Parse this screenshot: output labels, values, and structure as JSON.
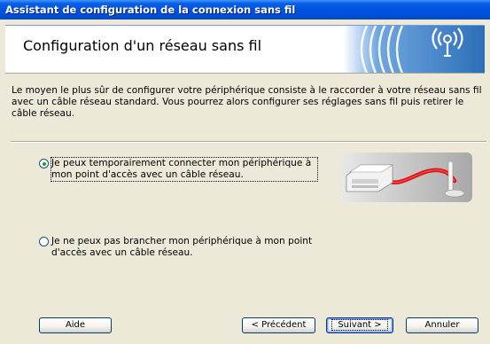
{
  "window": {
    "title": "Assistant de configuration de la connexion sans fil"
  },
  "header": {
    "title": "Configuration d'un réseau sans fil",
    "logo_icon": "wireless-signal-icon"
  },
  "intro_text": "Le moyen le plus sûr de configurer votre périphérique consiste à le raccorder à votre réseau sans fil avec un câble réseau standard. Vous pourrez alors configurer ses réglages sans fil puis retirer le câble réseau.",
  "options": [
    {
      "label": "Je peux temporairement connecter mon périphérique à mon point d'accès avec un câble réseau.",
      "selected": true
    },
    {
      "label": "Je ne peux pas brancher mon périphérique à mon point d'accès avec un câble réseau.",
      "selected": false
    }
  ],
  "illustration": {
    "icon": "printer-cable-access-point-icon"
  },
  "buttons": {
    "help": "Aide",
    "back": "< Précédent",
    "next": "Suivant >",
    "cancel": "Annuler"
  },
  "colors": {
    "title_bar": "#0054E3",
    "window_bg": "#ECE9D8",
    "accent_blue": "#2C6FB8",
    "radio_selected": "#21A121",
    "cable_red": "#E01010"
  }
}
